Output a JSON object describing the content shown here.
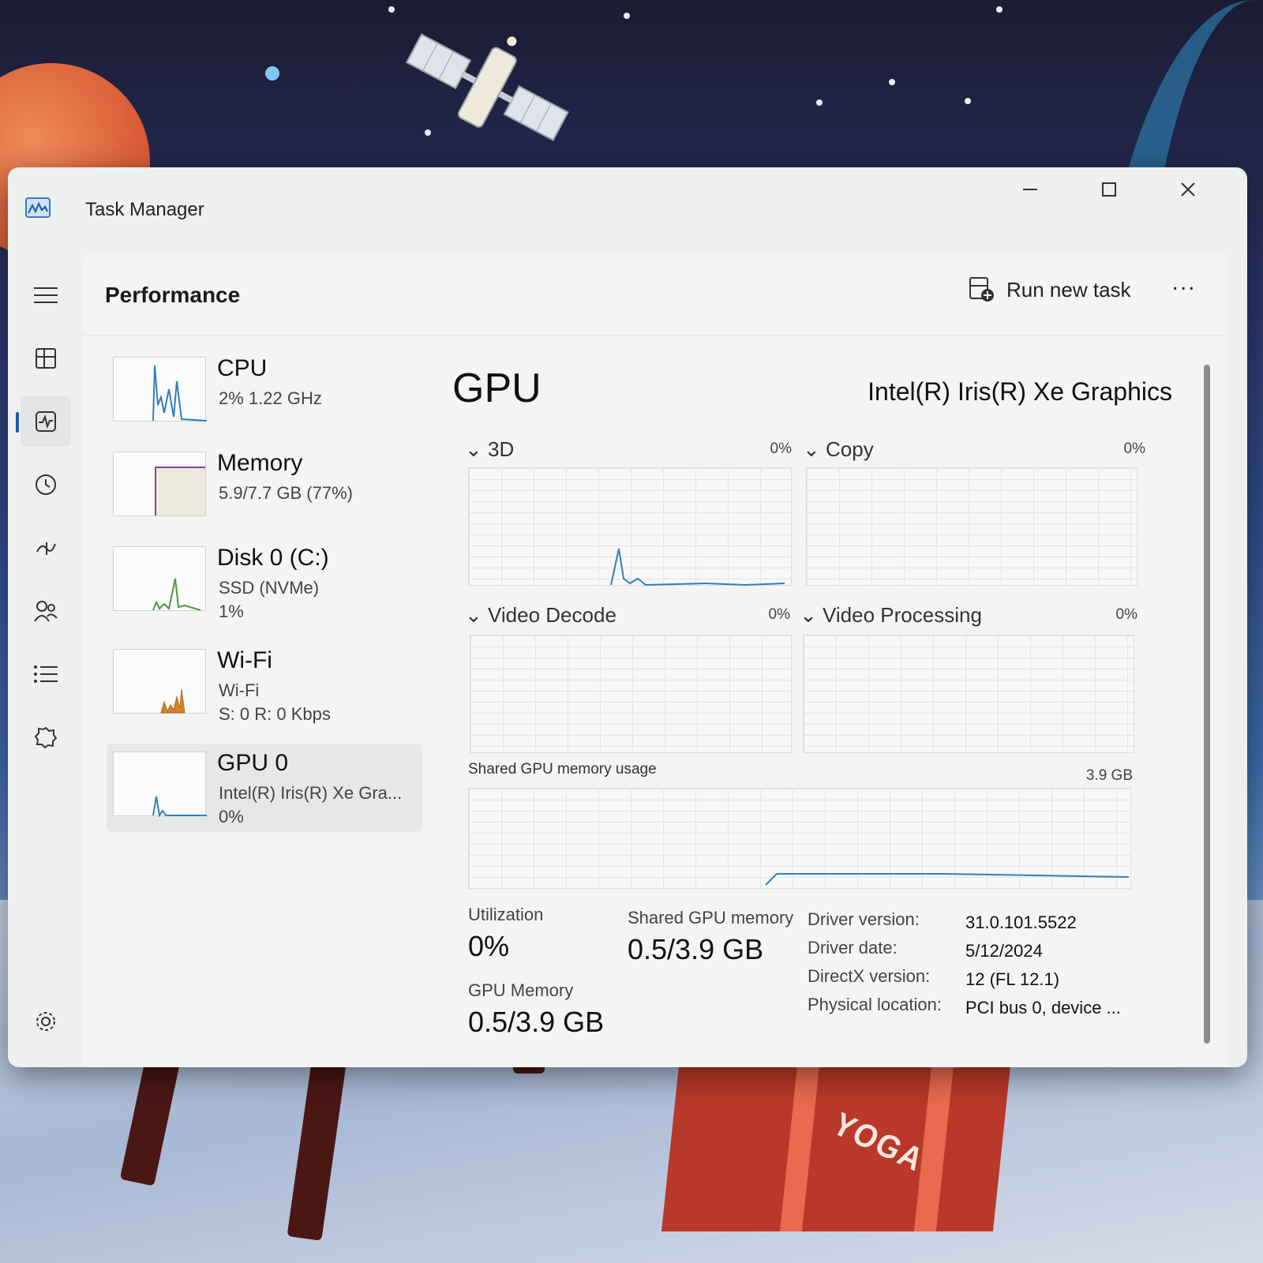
{
  "window": {
    "title": "Task Manager"
  },
  "nav": {
    "items": [
      {
        "icon": "hamburger-icon"
      },
      {
        "icon": "processes-icon"
      },
      {
        "icon": "performance-icon",
        "active": true
      },
      {
        "icon": "app-history-icon"
      },
      {
        "icon": "startup-apps-icon"
      },
      {
        "icon": "users-icon"
      },
      {
        "icon": "details-icon"
      },
      {
        "icon": "services-icon"
      },
      {
        "icon": "settings-icon"
      }
    ]
  },
  "header": {
    "title": "Performance",
    "run_new_task": "Run new task",
    "more": "..."
  },
  "devices": [
    {
      "name": "CPU",
      "sub1": "2%  1.22 GHz",
      "sub2": ""
    },
    {
      "name": "Memory",
      "sub1": "5.9/7.7 GB (77%)",
      "sub2": ""
    },
    {
      "name": "Disk 0 (C:)",
      "sub1": "SSD (NVMe)",
      "sub2": "1%"
    },
    {
      "name": "Wi-Fi",
      "sub1": "Wi-Fi",
      "sub2": "S: 0 R: 0 Kbps"
    },
    {
      "name": "GPU 0",
      "sub1": "Intel(R) Iris(R) Xe Gra...",
      "sub2": "0%"
    }
  ],
  "gpu": {
    "title": "GPU",
    "model": "Intel(R) Iris(R) Xe Graphics",
    "engines": [
      {
        "label": "3D",
        "pct": "0%"
      },
      {
        "label": "Copy",
        "pct": "0%"
      },
      {
        "label": "Video Decode",
        "pct": "0%"
      },
      {
        "label": "Video Processing",
        "pct": "0%"
      }
    ],
    "shared_label": "Shared GPU memory usage",
    "shared_max": "3.9 GB",
    "stats": {
      "utilization_label": "Utilization",
      "utilization_value": "0%",
      "shared_mem_label": "Shared GPU memory",
      "shared_mem_value": "0.5/3.9 GB",
      "gpu_mem_label": "GPU Memory",
      "gpu_mem_value": "0.5/3.9 GB"
    },
    "info": [
      {
        "k": "Driver version:",
        "v": "31.0.101.5522"
      },
      {
        "k": "Driver date:",
        "v": "5/12/2024"
      },
      {
        "k": "DirectX version:",
        "v": "12 (FL 12.1)"
      },
      {
        "k": "Physical location:",
        "v": "PCI bus 0, device ..."
      }
    ]
  },
  "wallpaper": {
    "bag_text": "YOGA"
  },
  "colors": {
    "accent": "#1f5aa8",
    "graph_line": "#2f7fc1",
    "selected_bg": "#e6e8e7"
  }
}
